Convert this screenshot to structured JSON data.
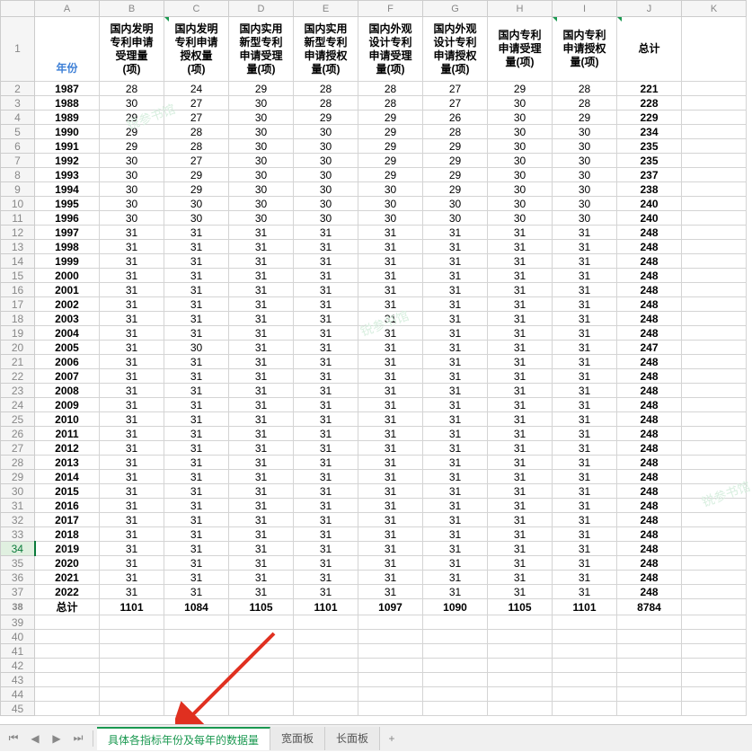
{
  "columns_letters": [
    "A",
    "B",
    "C",
    "D",
    "E",
    "F",
    "G",
    "H",
    "I",
    "J",
    "K"
  ],
  "headers": {
    "year": "年份",
    "cols": [
      "国内发明\n专利申请\n受理量\n(项)",
      "国内发明\n专利申请\n授权量\n(项)",
      "国内实用\n新型专利\n申请受理\n量(项)",
      "国内实用\n新型专利\n申请授权\n量(项)",
      "国内外观\n设计专利\n申请受理\n量(项)",
      "国内外观\n设计专利\n申请授权\n量(项)",
      "国内专利\n申请受理\n量(项)",
      "国内专利\n申请授权\n量(项)",
      "总计"
    ]
  },
  "rows": [
    {
      "y": "1987",
      "v": [
        28,
        24,
        29,
        28,
        28,
        27,
        29,
        28,
        221
      ]
    },
    {
      "y": "1988",
      "v": [
        30,
        27,
        30,
        28,
        28,
        27,
        30,
        28,
        228
      ]
    },
    {
      "y": "1989",
      "v": [
        29,
        27,
        30,
        29,
        29,
        26,
        30,
        29,
        229
      ]
    },
    {
      "y": "1990",
      "v": [
        29,
        28,
        30,
        30,
        29,
        28,
        30,
        30,
        234
      ]
    },
    {
      "y": "1991",
      "v": [
        29,
        28,
        30,
        30,
        29,
        29,
        30,
        30,
        235
      ]
    },
    {
      "y": "1992",
      "v": [
        30,
        27,
        30,
        30,
        29,
        29,
        30,
        30,
        235
      ]
    },
    {
      "y": "1993",
      "v": [
        30,
        29,
        30,
        30,
        29,
        29,
        30,
        30,
        237
      ]
    },
    {
      "y": "1994",
      "v": [
        30,
        29,
        30,
        30,
        30,
        29,
        30,
        30,
        238
      ]
    },
    {
      "y": "1995",
      "v": [
        30,
        30,
        30,
        30,
        30,
        30,
        30,
        30,
        240
      ]
    },
    {
      "y": "1996",
      "v": [
        30,
        30,
        30,
        30,
        30,
        30,
        30,
        30,
        240
      ]
    },
    {
      "y": "1997",
      "v": [
        31,
        31,
        31,
        31,
        31,
        31,
        31,
        31,
        248
      ]
    },
    {
      "y": "1998",
      "v": [
        31,
        31,
        31,
        31,
        31,
        31,
        31,
        31,
        248
      ]
    },
    {
      "y": "1999",
      "v": [
        31,
        31,
        31,
        31,
        31,
        31,
        31,
        31,
        248
      ]
    },
    {
      "y": "2000",
      "v": [
        31,
        31,
        31,
        31,
        31,
        31,
        31,
        31,
        248
      ]
    },
    {
      "y": "2001",
      "v": [
        31,
        31,
        31,
        31,
        31,
        31,
        31,
        31,
        248
      ]
    },
    {
      "y": "2002",
      "v": [
        31,
        31,
        31,
        31,
        31,
        31,
        31,
        31,
        248
      ]
    },
    {
      "y": "2003",
      "v": [
        31,
        31,
        31,
        31,
        31,
        31,
        31,
        31,
        248
      ]
    },
    {
      "y": "2004",
      "v": [
        31,
        31,
        31,
        31,
        31,
        31,
        31,
        31,
        248
      ]
    },
    {
      "y": "2005",
      "v": [
        31,
        30,
        31,
        31,
        31,
        31,
        31,
        31,
        247
      ]
    },
    {
      "y": "2006",
      "v": [
        31,
        31,
        31,
        31,
        31,
        31,
        31,
        31,
        248
      ]
    },
    {
      "y": "2007",
      "v": [
        31,
        31,
        31,
        31,
        31,
        31,
        31,
        31,
        248
      ]
    },
    {
      "y": "2008",
      "v": [
        31,
        31,
        31,
        31,
        31,
        31,
        31,
        31,
        248
      ]
    },
    {
      "y": "2009",
      "v": [
        31,
        31,
        31,
        31,
        31,
        31,
        31,
        31,
        248
      ]
    },
    {
      "y": "2010",
      "v": [
        31,
        31,
        31,
        31,
        31,
        31,
        31,
        31,
        248
      ]
    },
    {
      "y": "2011",
      "v": [
        31,
        31,
        31,
        31,
        31,
        31,
        31,
        31,
        248
      ]
    },
    {
      "y": "2012",
      "v": [
        31,
        31,
        31,
        31,
        31,
        31,
        31,
        31,
        248
      ]
    },
    {
      "y": "2013",
      "v": [
        31,
        31,
        31,
        31,
        31,
        31,
        31,
        31,
        248
      ]
    },
    {
      "y": "2014",
      "v": [
        31,
        31,
        31,
        31,
        31,
        31,
        31,
        31,
        248
      ]
    },
    {
      "y": "2015",
      "v": [
        31,
        31,
        31,
        31,
        31,
        31,
        31,
        31,
        248
      ]
    },
    {
      "y": "2016",
      "v": [
        31,
        31,
        31,
        31,
        31,
        31,
        31,
        31,
        248
      ]
    },
    {
      "y": "2017",
      "v": [
        31,
        31,
        31,
        31,
        31,
        31,
        31,
        31,
        248
      ]
    },
    {
      "y": "2018",
      "v": [
        31,
        31,
        31,
        31,
        31,
        31,
        31,
        31,
        248
      ]
    },
    {
      "y": "2019",
      "v": [
        31,
        31,
        31,
        31,
        31,
        31,
        31,
        31,
        248
      ]
    },
    {
      "y": "2020",
      "v": [
        31,
        31,
        31,
        31,
        31,
        31,
        31,
        31,
        248
      ]
    },
    {
      "y": "2021",
      "v": [
        31,
        31,
        31,
        31,
        31,
        31,
        31,
        31,
        248
      ]
    },
    {
      "y": "2022",
      "v": [
        31,
        31,
        31,
        31,
        31,
        31,
        31,
        31,
        248
      ]
    }
  ],
  "totals_label": "总计",
  "totals": [
    1101,
    1084,
    1105,
    1101,
    1097,
    1090,
    1105,
    1101,
    8784
  ],
  "empty_rows": [
    39,
    40,
    41,
    42,
    43,
    44,
    45
  ],
  "selected_row_gutter": 34,
  "tabs": {
    "active": "具体各指标年份及每年的数据量",
    "others": [
      "宽面板",
      "长面板"
    ],
    "add": "+"
  },
  "nav_glyphs": {
    "first": "⏮",
    "prev": "◀",
    "next": "▶",
    "last": "⏭"
  },
  "watermark_text": "锐参书馆"
}
